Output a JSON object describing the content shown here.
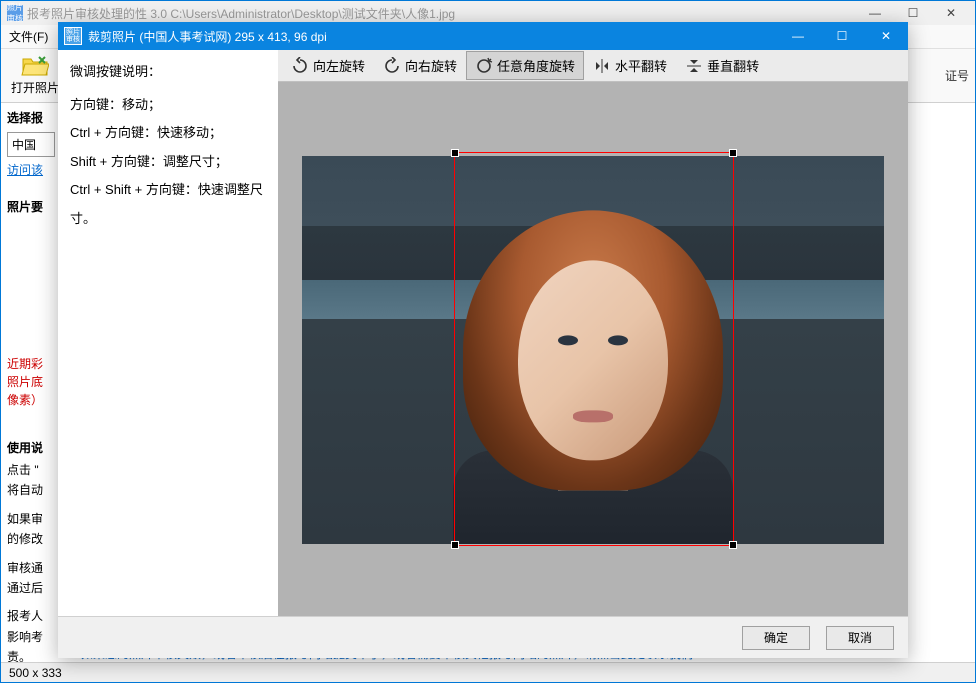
{
  "parent": {
    "title": "报考照片审核处理的性 3.0    C:\\Users\\Administrator\\Desktop\\测试文件夹\\人像1.jpg",
    "menu_file": "文件(F)",
    "open_photo": "打开照片",
    "select_label": "选择报",
    "dropdown_value": "中国",
    "visit_link": "访问该",
    "photo_req_label": "照片要",
    "warning_line1": "近期彩",
    "warning_line2": "照片底",
    "warning_line3": "像素）",
    "usage_title": "使用说",
    "usage_line1": "点击 \"",
    "usage_line2": "将自动",
    "usage_line3": "如果审",
    "usage_line4": "的修改",
    "usage_line5": "审核通",
    "usage_line6": "通过后",
    "usage_line7": "报考人",
    "usage_line8": "影响考",
    "usage_line9": "责。",
    "status_dim": "500 x 333",
    "blue_hint": "如果您的照片审核失败，或者审核后在报考网站提交不了，或者需要审核其他报考网站的照片，请点击此处联系我们",
    "cert_label": "证号"
  },
  "dialog": {
    "title": "裁剪照片 (中国人事考试网) 295 x 413, 96 dpi",
    "help_title": "微调按键说明：",
    "help_line1": "方向键：移动；",
    "help_line2": "Ctrl + 方向键：快速移动；",
    "help_line3": "Shift + 方向键：调整尺寸；",
    "help_line4": "Ctrl + Shift + 方向键：快速调整尺寸。",
    "toolbar": {
      "rotate_left": "向左旋转",
      "rotate_right": "向右旋转",
      "rotate_any": "任意角度旋转",
      "flip_h": "水平翻转",
      "flip_v": "垂直翻转"
    },
    "ok": "确定",
    "cancel": "取消"
  }
}
